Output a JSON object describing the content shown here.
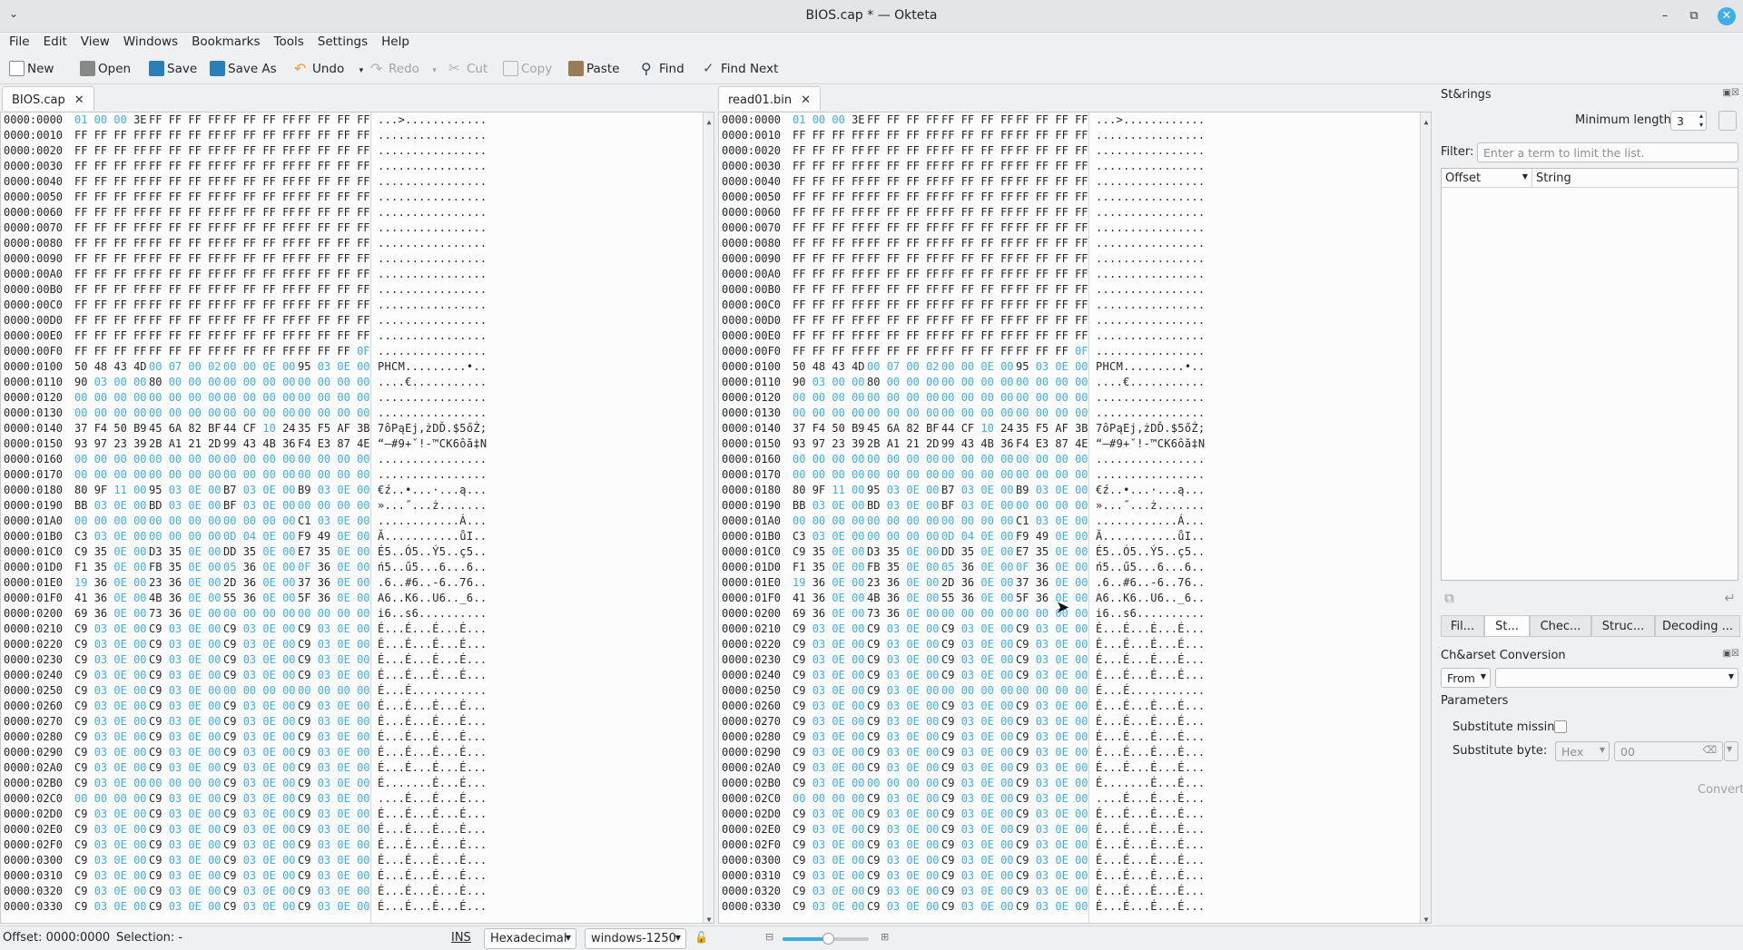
{
  "window": {
    "title": "BIOS.cap * — Okteta"
  },
  "menu": [
    "File",
    "Edit",
    "View",
    "Windows",
    "Bookmarks",
    "Tools",
    "Settings",
    "Help"
  ],
  "toolbar": {
    "new": "New",
    "open": "Open",
    "save": "Save",
    "save_as": "Save As",
    "undo": "Undo",
    "redo": "Redo",
    "cut": "Cut",
    "copy": "Copy",
    "paste": "Paste",
    "find": "Find",
    "find_next": "Find Next"
  },
  "tabs": {
    "left": "BIOS.cap",
    "right": "read01.bin"
  },
  "hex_rows": [
    [
      "0000:0000",
      "01 00 00 3E",
      "FF FF FF FF",
      "FF FF FF FF",
      "FF FF FF FF",
      "...>............"
    ],
    [
      "0000:0010",
      "FF FF FF FF",
      "FF FF FF FF",
      "FF FF FF FF",
      "FF FF FF FF",
      "................"
    ],
    [
      "0000:0020",
      "FF FF FF FF",
      "FF FF FF FF",
      "FF FF FF FF",
      "FF FF FF FF",
      "................"
    ],
    [
      "0000:0030",
      "FF FF FF FF",
      "FF FF FF FF",
      "FF FF FF FF",
      "FF FF FF FF",
      "................"
    ],
    [
      "0000:0040",
      "FF FF FF FF",
      "FF FF FF FF",
      "FF FF FF FF",
      "FF FF FF FF",
      "................"
    ],
    [
      "0000:0050",
      "FF FF FF FF",
      "FF FF FF FF",
      "FF FF FF FF",
      "FF FF FF FF",
      "................"
    ],
    [
      "0000:0060",
      "FF FF FF FF",
      "FF FF FF FF",
      "FF FF FF FF",
      "FF FF FF FF",
      "................"
    ],
    [
      "0000:0070",
      "FF FF FF FF",
      "FF FF FF FF",
      "FF FF FF FF",
      "FF FF FF FF",
      "................"
    ],
    [
      "0000:0080",
      "FF FF FF FF",
      "FF FF FF FF",
      "FF FF FF FF",
      "FF FF FF FF",
      "................"
    ],
    [
      "0000:0090",
      "FF FF FF FF",
      "FF FF FF FF",
      "FF FF FF FF",
      "FF FF FF FF",
      "................"
    ],
    [
      "0000:00A0",
      "FF FF FF FF",
      "FF FF FF FF",
      "FF FF FF FF",
      "FF FF FF FF",
      "................"
    ],
    [
      "0000:00B0",
      "FF FF FF FF",
      "FF FF FF FF",
      "FF FF FF FF",
      "FF FF FF FF",
      "................"
    ],
    [
      "0000:00C0",
      "FF FF FF FF",
      "FF FF FF FF",
      "FF FF FF FF",
      "FF FF FF FF",
      "................"
    ],
    [
      "0000:00D0",
      "FF FF FF FF",
      "FF FF FF FF",
      "FF FF FF FF",
      "FF FF FF FF",
      "................"
    ],
    [
      "0000:00E0",
      "FF FF FF FF",
      "FF FF FF FF",
      "FF FF FF FF",
      "FF FF FF FF",
      "................"
    ],
    [
      "0000:00F0",
      "FF FF FF FF",
      "FF FF FF FF",
      "FF FF FF FF",
      "FF FF FF 0F",
      "................"
    ],
    [
      "0000:0100",
      "50 48 43 4D",
      "00 07 00 02",
      "00 00 0E 00",
      "95 03 0E 00",
      "PHCM.........•.."
    ],
    [
      "0000:0110",
      "90 03 00 00",
      "80 00 00 00",
      "00 00 00 00",
      "00 00 00 00",
      "....€..........."
    ],
    [
      "0000:0120",
      "00 00 00 00",
      "00 00 00 00",
      "00 00 00 00",
      "00 00 00 00",
      "................"
    ],
    [
      "0000:0130",
      "00 00 00 00",
      "00 00 00 00",
      "00 00 00 00",
      "00 00 00 00",
      "................"
    ],
    [
      "0000:0140",
      "37 F4 50 B9",
      "45 6A 82 BF",
      "44 CF 10 24",
      "35 F5 AF 3B",
      "7ôPąEj‚żDĎ.$5őŻ;"
    ],
    [
      "0000:0150",
      "93 97 23 39",
      "2B A1 21 2D",
      "99 43 4B 36",
      "F4 E3 87 4E",
      "“—#9+ˇ!-™CK6ôă‡N"
    ],
    [
      "0000:0160",
      "00 00 00 00",
      "00 00 00 00",
      "00 00 00 00",
      "00 00 00 00",
      "................"
    ],
    [
      "0000:0170",
      "00 00 00 00",
      "00 00 00 00",
      "00 00 00 00",
      "00 00 00 00",
      "................"
    ],
    [
      "0000:0180",
      "80 9F 11 00",
      "95 03 0E 00",
      "B7 03 0E 00",
      "B9 03 0E 00",
      "€ź..•...·...ą..."
    ],
    [
      "0000:0190",
      "BB 03 0E 00",
      "BD 03 0E 00",
      "BF 03 0E 00",
      "00 00 00 00",
      "»...˝...ż......."
    ],
    [
      "0000:01A0",
      "00 00 00 00",
      "00 00 00 00",
      "00 00 00 00",
      "C1 03 0E 00",
      "............Á..."
    ],
    [
      "0000:01B0",
      "C3 03 0E 00",
      "00 00 00 00",
      "0D 04 0E 00",
      "F9 49 0E 00",
      "Ă...........ůI.."
    ],
    [
      "0000:01C0",
      "C9 35 0E 00",
      "D3 35 0E 00",
      "DD 35 0E 00",
      "E7 35 0E 00",
      "É5..Ó5..Ý5..ç5.."
    ],
    [
      "0000:01D0",
      "F1 35 0E 00",
      "FB 35 0E 00",
      "05 36 0E 00",
      "0F 36 0E 00",
      "ń5..ű5...6...6.."
    ],
    [
      "0000:01E0",
      "19 36 0E 00",
      "23 36 0E 00",
      "2D 36 0E 00",
      "37 36 0E 00",
      ".6..#6..-6..76.."
    ],
    [
      "0000:01F0",
      "41 36 0E 00",
      "4B 36 0E 00",
      "55 36 0E 00",
      "5F 36 0E 00",
      "A6..K6..U6.._6.."
    ],
    [
      "0000:0200",
      "69 36 0E 00",
      "73 36 0E 00",
      "00 00 00 00",
      "00 00 00 00",
      "i6..s6.........."
    ],
    [
      "0000:0210",
      "C9 03 0E 00",
      "C9 03 0E 00",
      "C9 03 0E 00",
      "C9 03 0E 00",
      "É...É...É...É..."
    ],
    [
      "0000:0220",
      "C9 03 0E 00",
      "C9 03 0E 00",
      "C9 03 0E 00",
      "C9 03 0E 00",
      "É...É...É...É..."
    ],
    [
      "0000:0230",
      "C9 03 0E 00",
      "C9 03 0E 00",
      "C9 03 0E 00",
      "C9 03 0E 00",
      "É...É...É...É..."
    ],
    [
      "0000:0240",
      "C9 03 0E 00",
      "C9 03 0E 00",
      "C9 03 0E 00",
      "C9 03 0E 00",
      "É...É...É...É..."
    ],
    [
      "0000:0250",
      "C9 03 0E 00",
      "C9 03 0E 00",
      "00 00 00 00",
      "00 00 00 00",
      "É...É..........."
    ],
    [
      "0000:0260",
      "C9 03 0E 00",
      "C9 03 0E 00",
      "C9 03 0E 00",
      "C9 03 0E 00",
      "É...É...É...É..."
    ],
    [
      "0000:0270",
      "C9 03 0E 00",
      "C9 03 0E 00",
      "C9 03 0E 00",
      "C9 03 0E 00",
      "É...É...É...É..."
    ],
    [
      "0000:0280",
      "C9 03 0E 00",
      "C9 03 0E 00",
      "C9 03 0E 00",
      "C9 03 0E 00",
      "É...É...É...É..."
    ],
    [
      "0000:0290",
      "C9 03 0E 00",
      "C9 03 0E 00",
      "C9 03 0E 00",
      "C9 03 0E 00",
      "É...É...É...É..."
    ],
    [
      "0000:02A0",
      "C9 03 0E 00",
      "C9 03 0E 00",
      "C9 03 0E 00",
      "C9 03 0E 00",
      "É...É...É...É..."
    ],
    [
      "0000:02B0",
      "C9 03 0E 00",
      "00 00 00 00",
      "C9 03 0E 00",
      "C9 03 0E 00",
      "É.......É...É..."
    ],
    [
      "0000:02C0",
      "00 00 00 00",
      "C9 03 0E 00",
      "C9 03 0E 00",
      "C9 03 0E 00",
      "....É...É...É..."
    ],
    [
      "0000:02D0",
      "C9 03 0E 00",
      "C9 03 0E 00",
      "C9 03 0E 00",
      "C9 03 0E 00",
      "É...É...É...É..."
    ],
    [
      "0000:02E0",
      "C9 03 0E 00",
      "C9 03 0E 00",
      "C9 03 0E 00",
      "C9 03 0E 00",
      "É...É...É...É..."
    ],
    [
      "0000:02F0",
      "C9 03 0E 00",
      "C9 03 0E 00",
      "C9 03 0E 00",
      "C9 03 0E 00",
      "É...É...É...É..."
    ],
    [
      "0000:0300",
      "C9 03 0E 00",
      "C9 03 0E 00",
      "C9 03 0E 00",
      "C9 03 0E 00",
      "É...É...É...É..."
    ],
    [
      "0000:0310",
      "C9 03 0E 00",
      "C9 03 0E 00",
      "C9 03 0E 00",
      "C9 03 0E 00",
      "É...É...É...É..."
    ],
    [
      "0000:0320",
      "C9 03 0E 00",
      "C9 03 0E 00",
      "C9 03 0E 00",
      "C9 03 0E 00",
      "É...É...É...É..."
    ],
    [
      "0000:0330",
      "C9 03 0E 00",
      "C9 03 0E 00",
      "C9 03 0E 00",
      "C9 03 0E 00",
      "É...É...É...É..."
    ]
  ],
  "strings_panel": {
    "title": "St&rings",
    "min_length_label": "Minimum length:",
    "min_length_value": "3",
    "filter_label": "Filter:",
    "filter_placeholder": "Enter a term to limit the list.",
    "col_offset": "Offset",
    "col_string": "String"
  },
  "panel_tabs": [
    "Fil...",
    "St...",
    "Chec...",
    "Struc...",
    "Decoding ..."
  ],
  "charset_panel": {
    "title": "Ch&arset Conversion",
    "from": "From",
    "parameters": "Parameters",
    "substitute_missing": "Substitute missing:",
    "substitute_byte": "Substitute byte:",
    "sub_format": "Hex",
    "sub_value": "00",
    "convert": "Convert"
  },
  "status": {
    "offset": "Offset: 0000:0000",
    "selection": "Selection: -",
    "ins": "INS",
    "encoding": "Hexadecimal",
    "charset": "windows-1250"
  }
}
